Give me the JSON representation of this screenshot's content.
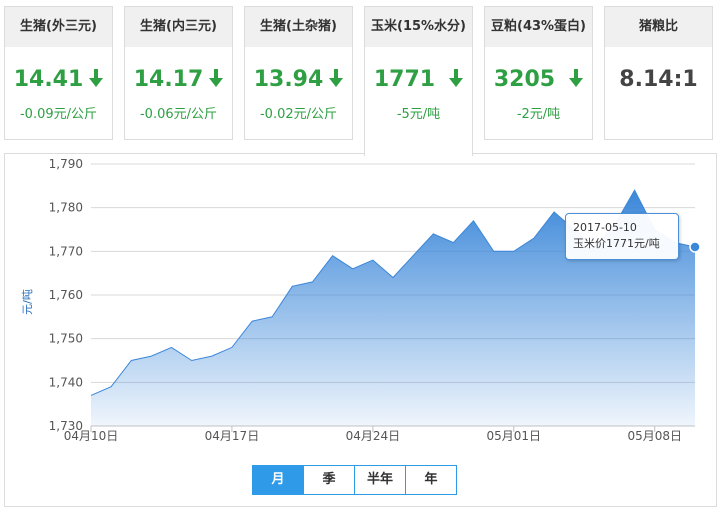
{
  "cards": [
    {
      "title": "生猪(外三元)",
      "price": "14.41",
      "arrow": "down",
      "change": "-0.09元/公斤"
    },
    {
      "title": "生猪(内三元)",
      "price": "14.17",
      "arrow": "down",
      "change": "-0.06元/公斤"
    },
    {
      "title": "生猪(土杂猪)",
      "price": "13.94",
      "arrow": "down",
      "change": "-0.02元/公斤"
    },
    {
      "title": "玉米(15%水分)",
      "price": "1771",
      "arrow": "down",
      "change": "-5元/吨"
    },
    {
      "title": "豆粕(43%蛋白)",
      "price": "3205",
      "arrow": "down",
      "change": "-2元/吨"
    },
    {
      "title": "猪粮比",
      "price": "8.14:1",
      "arrow": "none",
      "change": ""
    }
  ],
  "active_card": 3,
  "colors": {
    "down": "#2ea043",
    "area": "#3b87d9",
    "accent": "#2f9be8"
  },
  "chart_data": {
    "type": "area",
    "title": "",
    "xlabel": "",
    "ylabel": "元/吨",
    "ylim": [
      1730,
      1790
    ],
    "yticks": [
      "1,730",
      "1,740",
      "1,750",
      "1,760",
      "1,770",
      "1,780",
      "1,790"
    ],
    "grid": true,
    "x_tick_labels": [
      "04月10日",
      "04月17日",
      "04月24日",
      "05月01日",
      "05月08日"
    ],
    "series": [
      {
        "x": [
          "2017-04-10",
          "2017-04-11",
          "2017-04-12",
          "2017-04-13",
          "2017-04-14",
          "2017-04-15",
          "2017-04-16",
          "2017-04-17",
          "2017-04-18",
          "2017-04-19",
          "2017-04-20",
          "2017-04-21",
          "2017-04-22",
          "2017-04-23",
          "2017-04-24",
          "2017-04-25",
          "2017-04-26",
          "2017-04-27",
          "2017-04-28",
          "2017-04-29",
          "2017-04-30",
          "2017-05-01",
          "2017-05-02",
          "2017-05-03",
          "2017-05-04",
          "2017-05-05",
          "2017-05-06",
          "2017-05-07",
          "2017-05-08",
          "2017-05-09",
          "2017-05-10"
        ],
        "values": [
          1737,
          1739,
          1745,
          1746,
          1748,
          1745,
          1746,
          1748,
          1754,
          1755,
          1762,
          1763,
          1769,
          1766,
          1768,
          1764,
          1769,
          1774,
          1772,
          1777,
          1770,
          1770,
          1773,
          1779,
          1775,
          1771,
          1776,
          1784,
          1775,
          1772,
          1771
        ]
      }
    ]
  },
  "tooltip": {
    "date": "2017-05-10",
    "text": "玉米价1771元/吨"
  },
  "range_buttons": [
    "月",
    "季",
    "半年",
    "年"
  ],
  "active_range": 0
}
